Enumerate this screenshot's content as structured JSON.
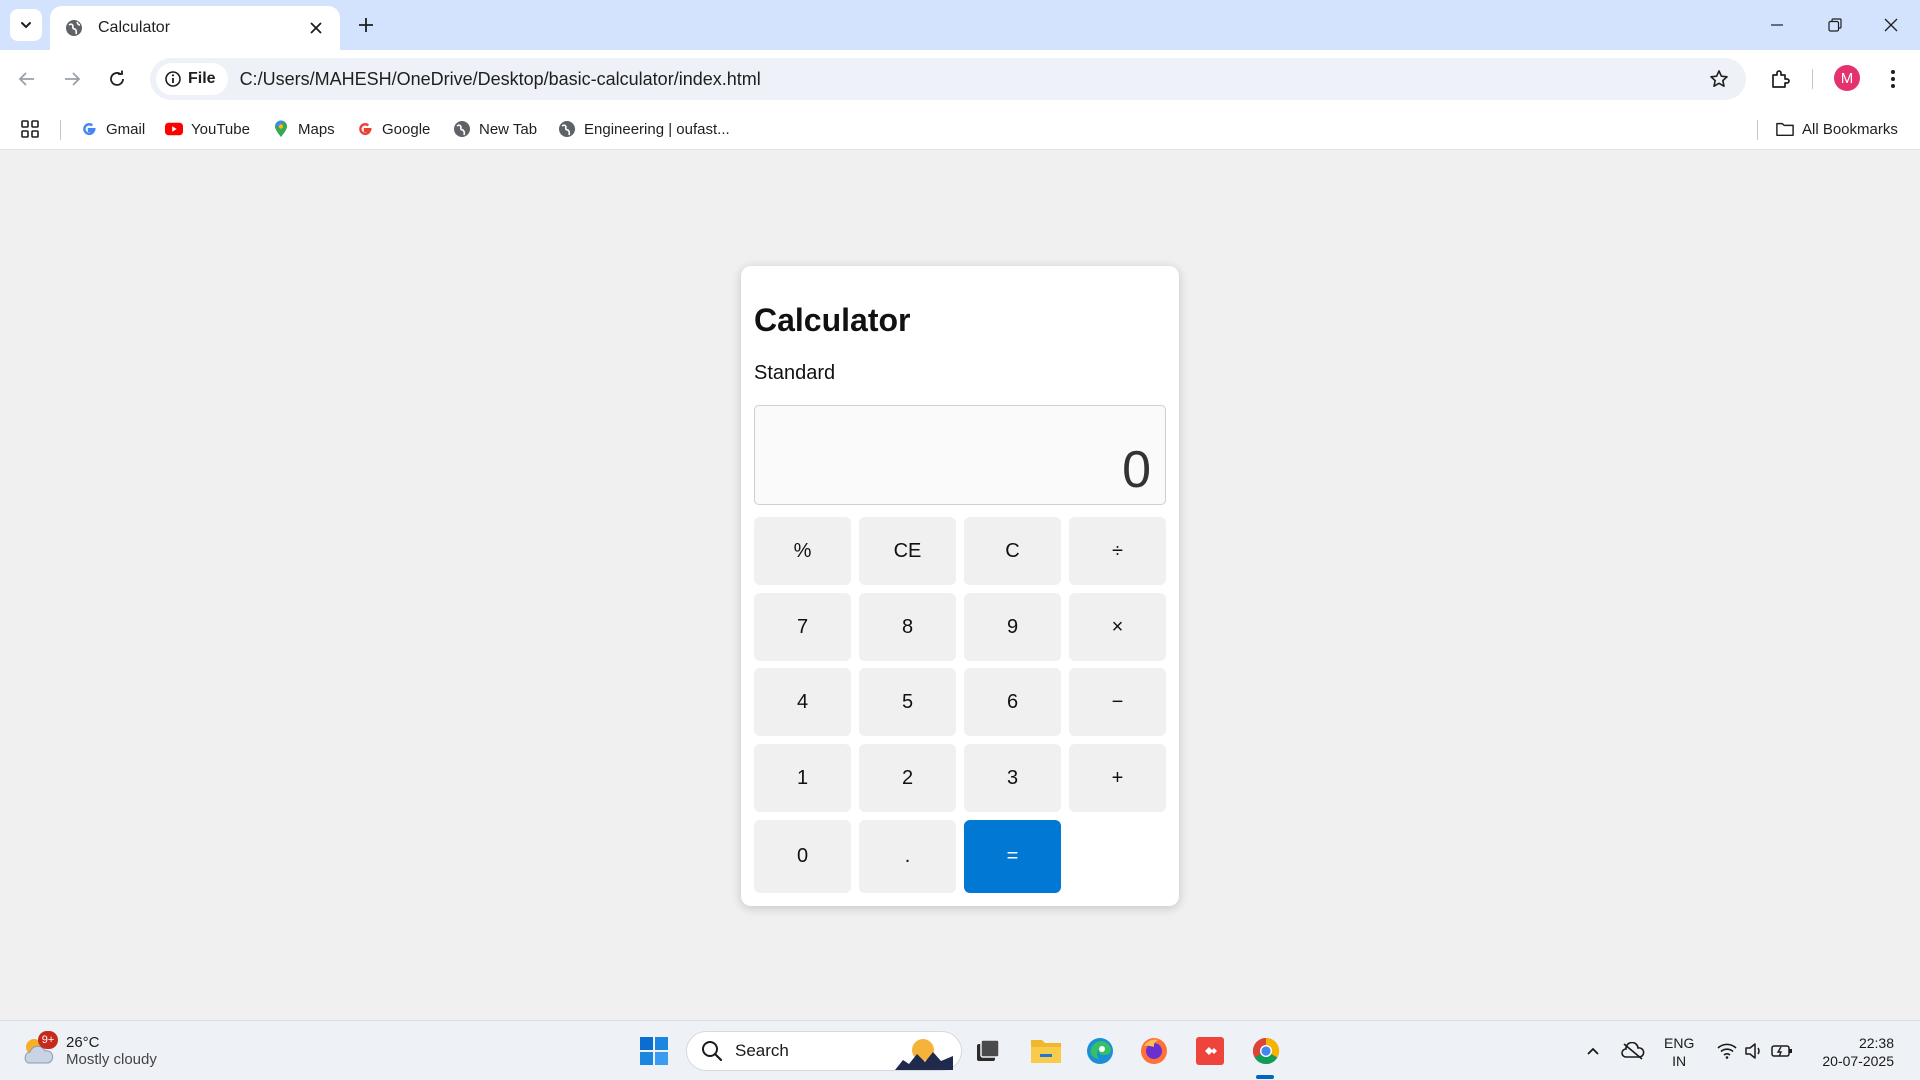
{
  "browser": {
    "tab_title": "Calculator",
    "site_chip_label": "File",
    "url": "C:/Users/MAHESH/OneDrive/Desktop/basic-calculator/index.html",
    "profile_initial": "M",
    "bookmarks": [
      {
        "label": "Gmail",
        "icon": "google-icon"
      },
      {
        "label": "YouTube",
        "icon": "youtube-icon"
      },
      {
        "label": "Maps",
        "icon": "maps-icon"
      },
      {
        "label": "Google",
        "icon": "google-icon"
      },
      {
        "label": "New Tab",
        "icon": "globe-icon"
      },
      {
        "label": "Engineering | oufast...",
        "icon": "globe-icon"
      }
    ],
    "all_bookmarks_label": "All Bookmarks"
  },
  "calculator": {
    "title": "Calculator",
    "mode": "Standard",
    "display_value": "0",
    "keys": [
      "%",
      "CE",
      "C",
      "÷",
      "7",
      "8",
      "9",
      "×",
      "4",
      "5",
      "6",
      "−",
      "1",
      "2",
      "3",
      "+",
      "0",
      ".",
      "="
    ]
  },
  "taskbar": {
    "weather_temp": "26°C",
    "weather_condition": "Mostly cloudy",
    "weather_badge": "9+",
    "search_label": "Search",
    "lang_line1": "ENG",
    "lang_line2": "IN",
    "time": "22:38",
    "date": "20-07-2025"
  },
  "colors": {
    "tabstrip_bg": "#d3e3fd",
    "equals_key": "#0078d4",
    "page_bg": "#f0f0f0",
    "key_bg": "#f0f0f0"
  }
}
